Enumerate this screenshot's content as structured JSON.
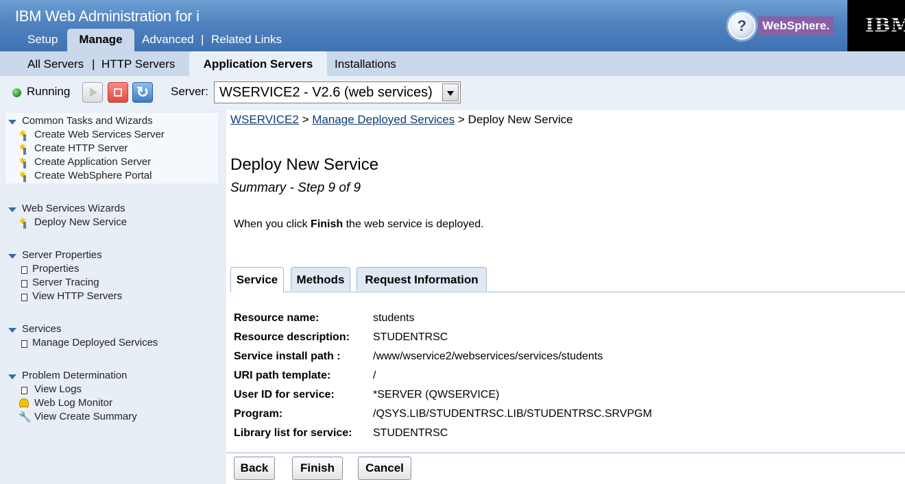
{
  "app": {
    "title": "IBM Web Administration for i"
  },
  "main_nav": {
    "setup": "Setup",
    "manage": "Manage",
    "advanced": "Advanced",
    "related_links": "Related Links",
    "separator": "|"
  },
  "branding": {
    "help": "?",
    "websphere": "WebSphere.",
    "ibm": "IBM"
  },
  "sub_nav": {
    "all_servers": "All Servers",
    "http_servers": "HTTP Servers",
    "application_servers": "Application Servers",
    "installations": "Installations",
    "separator": "|"
  },
  "server_bar": {
    "status": "Running",
    "refresh_glyph": "↻",
    "server_label": "Server:",
    "server_value": "WSERVICE2 - V2.6 (web services)"
  },
  "sidebar": {
    "common_tasks": {
      "title": "Common Tasks and Wizards",
      "items": [
        "Create Web Services Server",
        "Create HTTP Server",
        "Create Application Server",
        "Create WebSphere Portal"
      ]
    },
    "ws_wizards": {
      "title": "Web Services Wizards",
      "items": [
        "Deploy New Service"
      ]
    },
    "server_properties": {
      "title": "Server Properties",
      "items": [
        "Properties",
        "Server Tracing",
        "View HTTP Servers"
      ]
    },
    "services": {
      "title": "Services",
      "items": [
        "Manage Deployed Services"
      ]
    },
    "problem_determination": {
      "title": "Problem Determination",
      "items": [
        "View Logs",
        "Web Log Monitor",
        "View Create Summary"
      ]
    }
  },
  "breadcrumb": {
    "server": "WSERVICE2",
    "sep": ">",
    "manage": "Manage Deployed Services",
    "current": "Deploy New Service"
  },
  "page": {
    "title": "Deploy New Service",
    "step": "Summary - Step 9 of 9",
    "instruction_pre": "When you click ",
    "instruction_bold": "Finish",
    "instruction_post": " the web service is deployed."
  },
  "tabs": {
    "service": "Service",
    "methods": "Methods",
    "request_information": "Request Information"
  },
  "properties": [
    {
      "label": "Resource name:",
      "value": "students"
    },
    {
      "label": "Resource description:",
      "value": "STUDENTRSC"
    },
    {
      "label": "Service install path :",
      "value": "/www/wservice2/webservices/services/students"
    },
    {
      "label": "URI path template:",
      "value": "/"
    },
    {
      "label": "User ID for service:",
      "value": "*SERVER (QWSERVICE)"
    },
    {
      "label": "Program:",
      "value": "/QSYS.LIB/STUDENTRSC.LIB/STUDENTRSC.SRVPGM"
    },
    {
      "label": "Library list for service:",
      "value": "STUDENTRSC"
    }
  ],
  "buttons": {
    "back": "Back",
    "finish": "Finish",
    "cancel": "Cancel"
  }
}
